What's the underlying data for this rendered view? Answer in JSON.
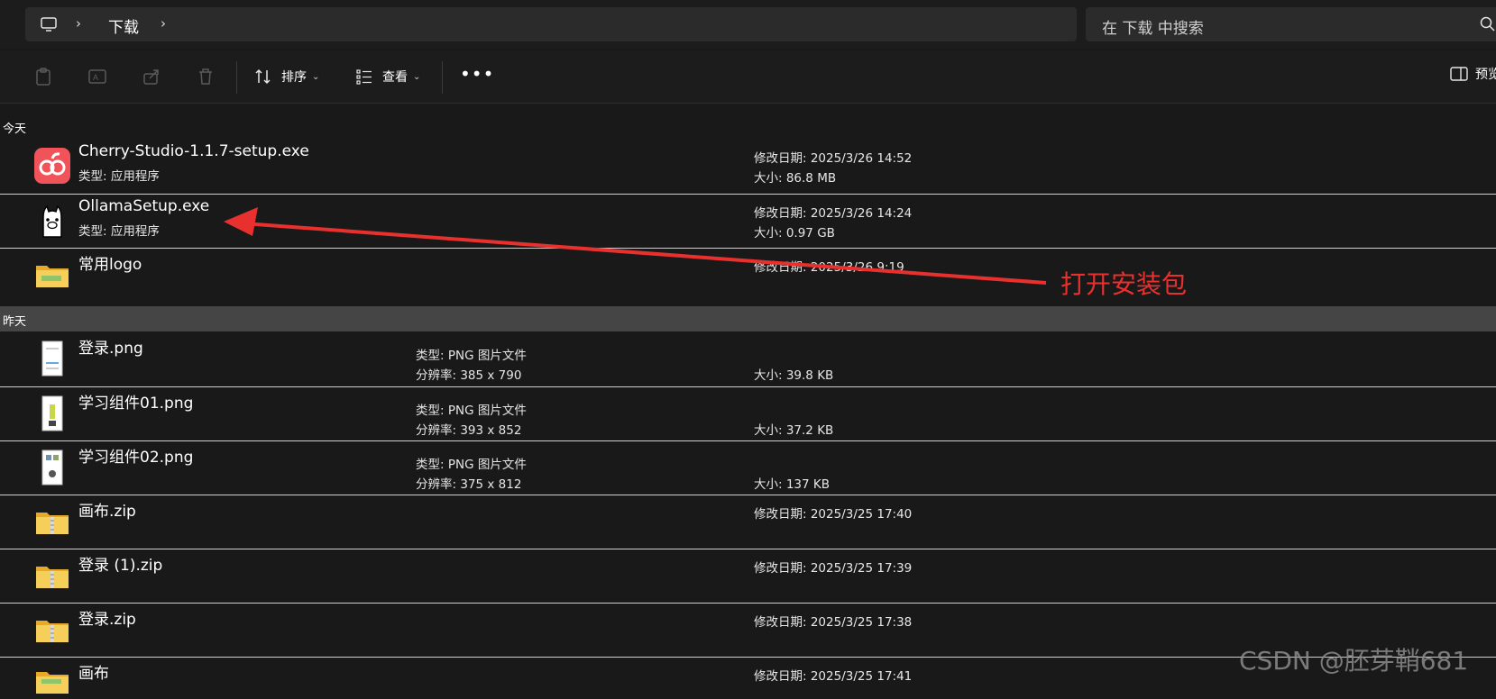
{
  "address_bar": {
    "breadcrumb": [
      "下载"
    ],
    "search_placeholder": "在 下载 中搜索"
  },
  "toolbar": {
    "sort_label": "排序",
    "view_label": "查看",
    "preview_label": "预览"
  },
  "groups": [
    {
      "title": "今天",
      "items": [
        {
          "name": "Cherry-Studio-1.1.7-setup.exe",
          "sub": "类型: 应用程序",
          "r1": "修改日期: 2025/3/26 14:52",
          "r2": "大小: 86.8 MB",
          "icon": "cherry-app-icon"
        },
        {
          "name": "OllamaSetup.exe",
          "sub": "类型: 应用程序",
          "r1": "修改日期: 2025/3/26 14:24",
          "r2": "大小: 0.97 GB",
          "icon": "ollama-app-icon"
        },
        {
          "name": "常用logo",
          "r1": "修改日期: 2025/3/26 9:19",
          "icon": "folder-icon"
        }
      ]
    },
    {
      "title": "昨天",
      "items": [
        {
          "name": "登录.png",
          "mid1": "类型: PNG 图片文件",
          "mid2": "分辨率: 385 x 790",
          "size": "大小: 39.8 KB",
          "icon": "image-thumb-icon"
        },
        {
          "name": "学习组件01.png",
          "mid1": "类型: PNG 图片文件",
          "mid2": "分辨率: 393 x 852",
          "size": "大小: 37.2 KB",
          "icon": "image-thumb-icon"
        },
        {
          "name": "学习组件02.png",
          "mid1": "类型: PNG 图片文件",
          "mid2": "分辨率: 375 x 812",
          "size": "大小: 137 KB",
          "icon": "image-thumb-icon"
        },
        {
          "name": "画布.zip",
          "r1": "修改日期: 2025/3/25 17:40",
          "icon": "zip-folder-icon"
        },
        {
          "name": "登录 (1).zip",
          "r1": "修改日期: 2025/3/25 17:39",
          "icon": "zip-folder-icon"
        },
        {
          "name": "登录.zip",
          "r1": "修改日期: 2025/3/25 17:38",
          "icon": "zip-folder-icon"
        },
        {
          "name": "画布",
          "r1": "修改日期: 2025/3/25 17:41",
          "icon": "folder-icon"
        }
      ]
    }
  ],
  "annotation": {
    "text": "打开安装包",
    "color": "#e8312f"
  },
  "watermark": "CSDN @胚芽鞘681"
}
